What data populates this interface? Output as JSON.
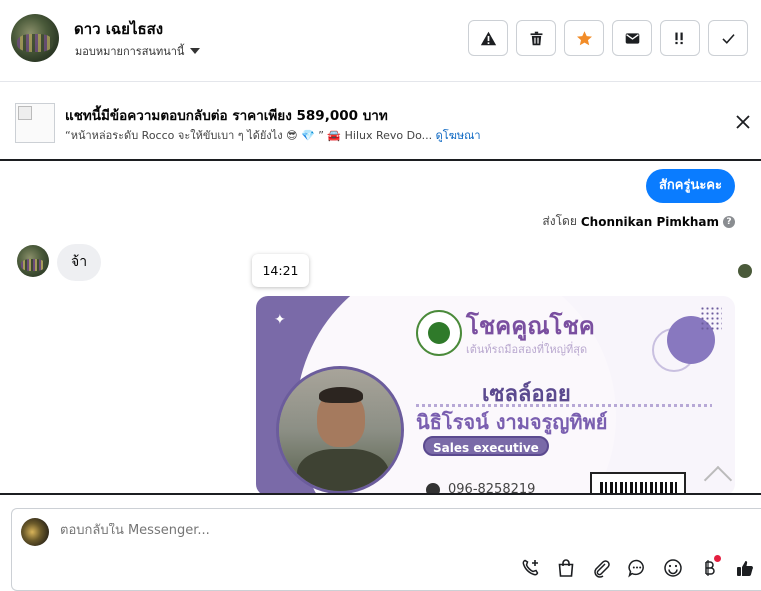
{
  "header": {
    "contact_name": "ดาว เฉยไธสง",
    "assign_label": "มอบหมายการสนทนานี้",
    "actions": [
      {
        "name": "report-button",
        "icon": "warning-icon"
      },
      {
        "name": "delete-button",
        "icon": "trash-icon"
      },
      {
        "name": "star-button",
        "icon": "star-icon",
        "color": "#f28c28"
      },
      {
        "name": "mark-unread-button",
        "icon": "envelope-icon"
      },
      {
        "name": "important-button",
        "icon": "exclamation-icon"
      },
      {
        "name": "done-button",
        "icon": "check-icon"
      }
    ]
  },
  "ad": {
    "title": "แชทนี้มีข้อความตอบกลับต่อ ราคาเพียง 589,000 บาท",
    "subtitle": "“หน้าหล่อระดับ Rocco จะให้ขับเบา ๆ ได้ยังไง 😎 💎 ” 🚘 Hilux Revo Do...",
    "link": "ดูโฆษณา"
  },
  "messages": {
    "outgoing_text": "สักครู่นะคะ",
    "sent_by_prefix": "ส่งโดย",
    "sent_by_name": "Chonnikan Pimkham",
    "help_mark": "?",
    "incoming_text": "จ้า",
    "timestamp": "14:21"
  },
  "card_image": {
    "brand": "โชคคูณโชค",
    "tagline": "เต้นท์รถมือสองที่ใหญ่ที่สุด",
    "role": "เซลล์ออย",
    "name": "นิธิโรจน์  งามจรูญทิพย์",
    "title": "Sales executive",
    "phone": "096-8258219"
  },
  "composer": {
    "placeholder": "ตอบกลับใน Messenger...",
    "tools": [
      "call-add-icon",
      "bag-icon",
      "attachment-icon",
      "chat-bubble-icon",
      "emoji-icon",
      "baht-icon",
      "thumbs-up-icon"
    ]
  },
  "colors": {
    "accent": "#0a7cff",
    "link": "#0a66c2",
    "notification": "#e41e3f"
  }
}
